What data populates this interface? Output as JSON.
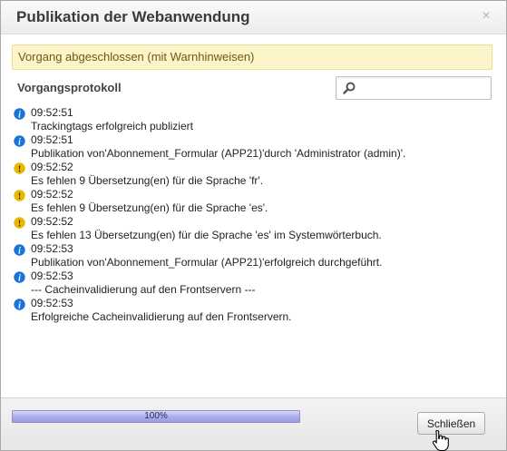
{
  "dialog": {
    "title": "Publikation der Webanwendung",
    "close_symbol": "×",
    "notice": "Vorgang abgeschlossen (mit Warnhinweisen)",
    "section_title": "Vorgangsprotokoll",
    "search": {
      "value": "",
      "placeholder": "",
      "icon": "search-icon"
    }
  },
  "log": [
    {
      "type": "info",
      "time": "09:52:51",
      "message": "Trackingtags erfolgreich publiziert"
    },
    {
      "type": "info",
      "time": "09:52:51",
      "message": "Publikation von'Abonnement_Formular (APP21)'durch 'Administrator (admin)'."
    },
    {
      "type": "warning",
      "time": "09:52:52",
      "message": "Es fehlen 9 Übersetzung(en) für die Sprache 'fr'."
    },
    {
      "type": "warning",
      "time": "09:52:52",
      "message": "Es fehlen 9 Übersetzung(en) für die Sprache 'es'."
    },
    {
      "type": "warning",
      "time": "09:52:52",
      "message": "Es fehlen 13 Übersetzung(en) für die Sprache 'es' im Systemwörterbuch."
    },
    {
      "type": "info",
      "time": "09:52:53",
      "message": "Publikation von'Abonnement_Formular (APP21)'erfolgreich durchgeführt."
    },
    {
      "type": "info",
      "time": "09:52:53",
      "message": "--- Cacheinvalidierung auf den Frontservern ---"
    },
    {
      "type": "info",
      "time": "09:52:53",
      "message": "Erfolgreiche Cacheinvalidierung auf den Frontservern."
    }
  ],
  "footer": {
    "progress_label": "100%",
    "progress_fraction": 1.0,
    "close_button_label": "Schließen"
  },
  "colors": {
    "info": "#1a73d9",
    "warning": "#e6b800",
    "notice_bg": "#fcf5c9",
    "progress": "#a8acea"
  }
}
